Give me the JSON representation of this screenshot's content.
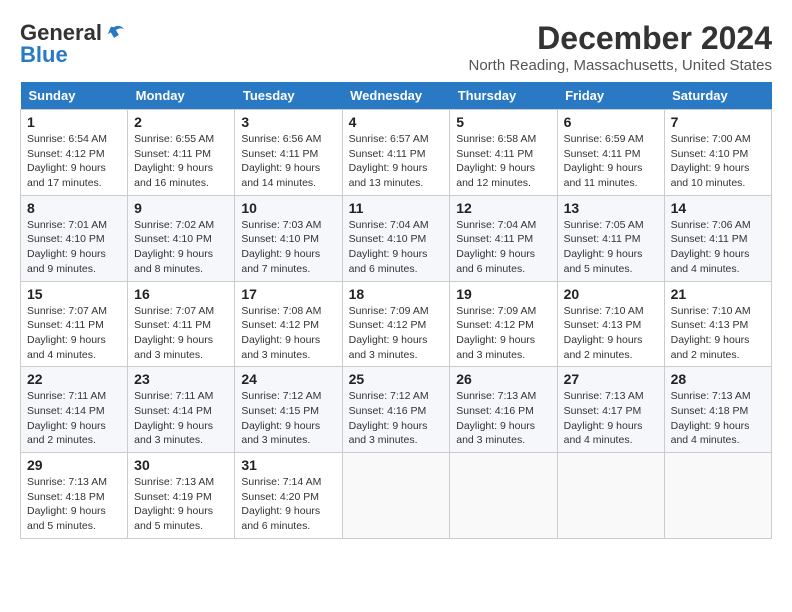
{
  "header": {
    "logo_line1": "General",
    "logo_line2": "Blue",
    "month": "December 2024",
    "location": "North Reading, Massachusetts, United States"
  },
  "weekdays": [
    "Sunday",
    "Monday",
    "Tuesday",
    "Wednesday",
    "Thursday",
    "Friday",
    "Saturday"
  ],
  "weeks": [
    [
      {
        "day": "1",
        "info": "Sunrise: 6:54 AM\nSunset: 4:12 PM\nDaylight: 9 hours and 17 minutes."
      },
      {
        "day": "2",
        "info": "Sunrise: 6:55 AM\nSunset: 4:11 PM\nDaylight: 9 hours and 16 minutes."
      },
      {
        "day": "3",
        "info": "Sunrise: 6:56 AM\nSunset: 4:11 PM\nDaylight: 9 hours and 14 minutes."
      },
      {
        "day": "4",
        "info": "Sunrise: 6:57 AM\nSunset: 4:11 PM\nDaylight: 9 hours and 13 minutes."
      },
      {
        "day": "5",
        "info": "Sunrise: 6:58 AM\nSunset: 4:11 PM\nDaylight: 9 hours and 12 minutes."
      },
      {
        "day": "6",
        "info": "Sunrise: 6:59 AM\nSunset: 4:11 PM\nDaylight: 9 hours and 11 minutes."
      },
      {
        "day": "7",
        "info": "Sunrise: 7:00 AM\nSunset: 4:10 PM\nDaylight: 9 hours and 10 minutes."
      }
    ],
    [
      {
        "day": "8",
        "info": "Sunrise: 7:01 AM\nSunset: 4:10 PM\nDaylight: 9 hours and 9 minutes."
      },
      {
        "day": "9",
        "info": "Sunrise: 7:02 AM\nSunset: 4:10 PM\nDaylight: 9 hours and 8 minutes."
      },
      {
        "day": "10",
        "info": "Sunrise: 7:03 AM\nSunset: 4:10 PM\nDaylight: 9 hours and 7 minutes."
      },
      {
        "day": "11",
        "info": "Sunrise: 7:04 AM\nSunset: 4:10 PM\nDaylight: 9 hours and 6 minutes."
      },
      {
        "day": "12",
        "info": "Sunrise: 7:04 AM\nSunset: 4:11 PM\nDaylight: 9 hours and 6 minutes."
      },
      {
        "day": "13",
        "info": "Sunrise: 7:05 AM\nSunset: 4:11 PM\nDaylight: 9 hours and 5 minutes."
      },
      {
        "day": "14",
        "info": "Sunrise: 7:06 AM\nSunset: 4:11 PM\nDaylight: 9 hours and 4 minutes."
      }
    ],
    [
      {
        "day": "15",
        "info": "Sunrise: 7:07 AM\nSunset: 4:11 PM\nDaylight: 9 hours and 4 minutes."
      },
      {
        "day": "16",
        "info": "Sunrise: 7:07 AM\nSunset: 4:11 PM\nDaylight: 9 hours and 3 minutes."
      },
      {
        "day": "17",
        "info": "Sunrise: 7:08 AM\nSunset: 4:12 PM\nDaylight: 9 hours and 3 minutes."
      },
      {
        "day": "18",
        "info": "Sunrise: 7:09 AM\nSunset: 4:12 PM\nDaylight: 9 hours and 3 minutes."
      },
      {
        "day": "19",
        "info": "Sunrise: 7:09 AM\nSunset: 4:12 PM\nDaylight: 9 hours and 3 minutes."
      },
      {
        "day": "20",
        "info": "Sunrise: 7:10 AM\nSunset: 4:13 PM\nDaylight: 9 hours and 2 minutes."
      },
      {
        "day": "21",
        "info": "Sunrise: 7:10 AM\nSunset: 4:13 PM\nDaylight: 9 hours and 2 minutes."
      }
    ],
    [
      {
        "day": "22",
        "info": "Sunrise: 7:11 AM\nSunset: 4:14 PM\nDaylight: 9 hours and 2 minutes."
      },
      {
        "day": "23",
        "info": "Sunrise: 7:11 AM\nSunset: 4:14 PM\nDaylight: 9 hours and 3 minutes."
      },
      {
        "day": "24",
        "info": "Sunrise: 7:12 AM\nSunset: 4:15 PM\nDaylight: 9 hours and 3 minutes."
      },
      {
        "day": "25",
        "info": "Sunrise: 7:12 AM\nSunset: 4:16 PM\nDaylight: 9 hours and 3 minutes."
      },
      {
        "day": "26",
        "info": "Sunrise: 7:13 AM\nSunset: 4:16 PM\nDaylight: 9 hours and 3 minutes."
      },
      {
        "day": "27",
        "info": "Sunrise: 7:13 AM\nSunset: 4:17 PM\nDaylight: 9 hours and 4 minutes."
      },
      {
        "day": "28",
        "info": "Sunrise: 7:13 AM\nSunset: 4:18 PM\nDaylight: 9 hours and 4 minutes."
      }
    ],
    [
      {
        "day": "29",
        "info": "Sunrise: 7:13 AM\nSunset: 4:18 PM\nDaylight: 9 hours and 5 minutes."
      },
      {
        "day": "30",
        "info": "Sunrise: 7:13 AM\nSunset: 4:19 PM\nDaylight: 9 hours and 5 minutes."
      },
      {
        "day": "31",
        "info": "Sunrise: 7:14 AM\nSunset: 4:20 PM\nDaylight: 9 hours and 6 minutes."
      },
      null,
      null,
      null,
      null
    ]
  ]
}
